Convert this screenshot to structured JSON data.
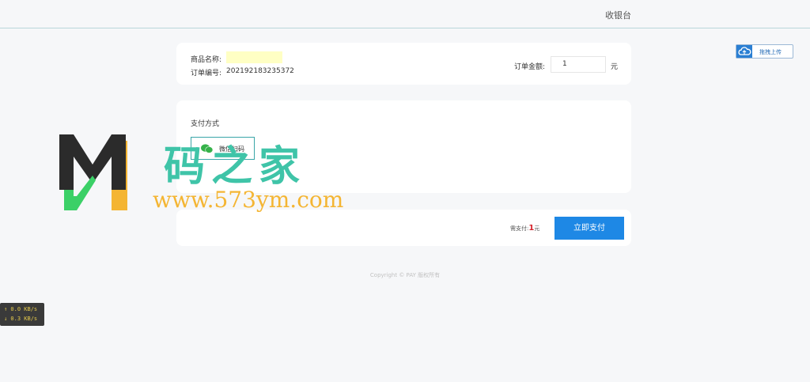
{
  "header": {
    "title": "收银台"
  },
  "order": {
    "name_label": "商品名称:",
    "name_value": "",
    "number_label": "订单编号:",
    "number_value": "202192183235372",
    "amount_label": "订单金额:",
    "amount_value": "1",
    "amount_unit": "元"
  },
  "payment": {
    "section_title": "支付方式",
    "options": [
      {
        "label": "微信扫码",
        "icon": "wechat-icon",
        "selected": true
      }
    ]
  },
  "submit": {
    "need_pay_label": "需支付:",
    "need_pay_amount": "1",
    "need_pay_unit": "元",
    "button_label": "立即支付"
  },
  "footer": {
    "copyright": "Copyright © PAY 版权所有"
  },
  "upload": {
    "label": "拖拽上传",
    "icon": "cloud-upload-icon"
  },
  "netspeed": {
    "up": "↑ 0.0 KB/s",
    "down": "↓ 0.3 KB/s"
  },
  "watermark": {
    "cn": "码之家",
    "url": "www.573ym.com"
  },
  "colors": {
    "accent": "#1e88e5",
    "price": "#d6252e",
    "option_border": "#3aa6a8"
  }
}
